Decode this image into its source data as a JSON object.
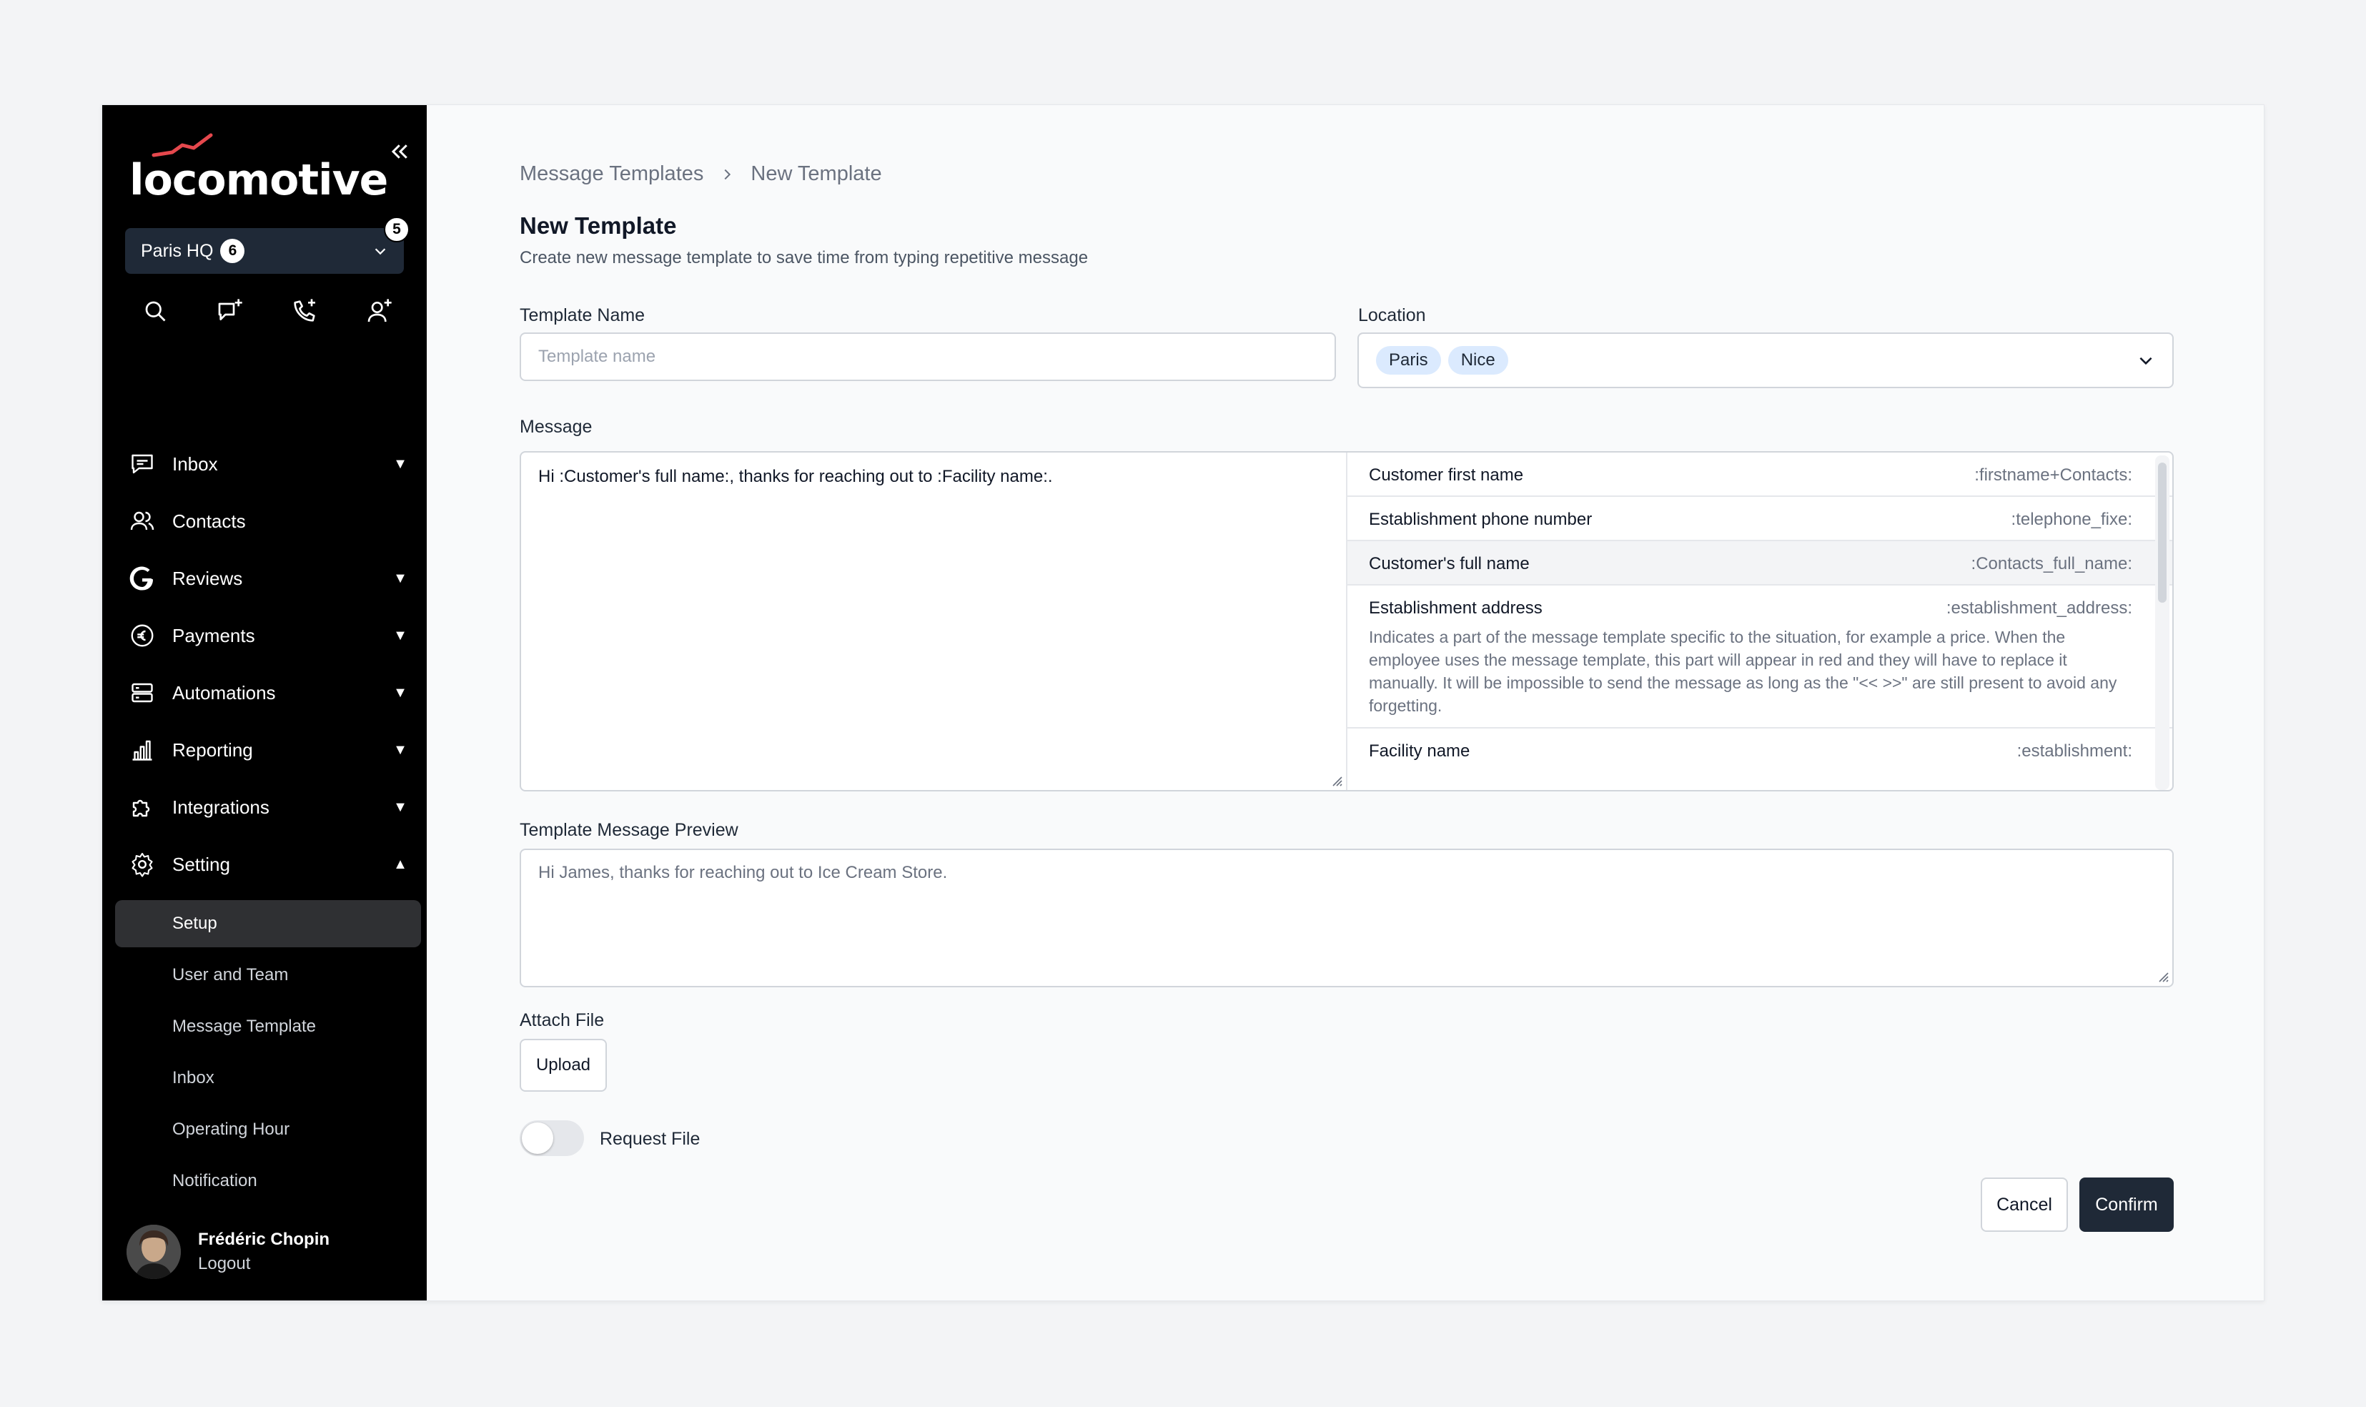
{
  "sidebar": {
    "logo_text": "locomotive",
    "location": {
      "name": "Paris HQ",
      "count": "6",
      "notification_count": "5"
    },
    "quick_actions": [
      "search-icon",
      "new-message-icon",
      "new-call-icon",
      "add-contact-icon"
    ],
    "nav": [
      {
        "label": "Inbox",
        "icon": "chat-icon",
        "caret": "▼"
      },
      {
        "label": "Contacts",
        "icon": "contacts-icon",
        "caret": ""
      },
      {
        "label": "Reviews",
        "icon": "google-icon",
        "caret": "▼"
      },
      {
        "label": "Payments",
        "icon": "euro-icon",
        "caret": "▼"
      },
      {
        "label": "Automations",
        "icon": "automation-icon",
        "caret": "▼"
      },
      {
        "label": "Reporting",
        "icon": "chart-icon",
        "caret": "▼"
      },
      {
        "label": "Integrations",
        "icon": "puzzle-icon",
        "caret": "▼"
      },
      {
        "label": "Setting",
        "icon": "gear-icon",
        "caret": "▲"
      }
    ],
    "setting_sub": [
      "Setup",
      "User and Team",
      "Message Template",
      "Inbox",
      "Operating Hour",
      "Notification"
    ],
    "user": {
      "name": "Frédéric Chopin",
      "logout": "Logout"
    }
  },
  "breadcrumb": {
    "parent": "Message Templates",
    "current": "New Template"
  },
  "page": {
    "title": "New Template",
    "subtitle": "Create new message template to save time from typing repetitive message"
  },
  "form": {
    "template_name": {
      "label": "Template Name",
      "placeholder": "Template name",
      "value": ""
    },
    "location": {
      "label": "Location",
      "chips": [
        "Paris",
        "Nice"
      ]
    },
    "message": {
      "label": "Message",
      "value": "Hi :Customer's full name:, thanks for reaching out to :Facility name:."
    },
    "variables": [
      {
        "name": "Customer first name",
        "code": ":firstname+Contacts:",
        "desc": ""
      },
      {
        "name": "Establishment phone number",
        "code": ":telephone_fixe:",
        "desc": ""
      },
      {
        "name": "Customer's full name",
        "code": ":Contacts_full_name:",
        "desc": ""
      },
      {
        "name": "Establishment address",
        "code": ":establishment_address:",
        "desc": "Indicates a part of the message template specific to the situation, for example a price. When the employee uses the message template, this part will appear in red and they will have to replace it manually. It will be impossible to send the message as long as the \"<< >>\" are still present to avoid any forgetting."
      },
      {
        "name": "Facility name",
        "code": ":establishment:",
        "desc": ""
      }
    ],
    "preview": {
      "label": "Template Message Preview",
      "value": "Hi James, thanks for reaching out to Ice Cream Store."
    },
    "attach": {
      "label": "Attach File",
      "button": "Upload"
    },
    "request_file": {
      "label": "Request File",
      "on": false
    }
  },
  "actions": {
    "cancel": "Cancel",
    "confirm": "Confirm"
  },
  "colors": {
    "sidebar_bg": "#000000",
    "primary_button": "#1f2937",
    "chip_bg": "#dbeafe",
    "logo_accent": "#e5484d"
  }
}
